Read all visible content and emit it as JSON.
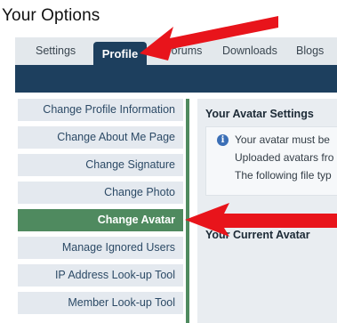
{
  "page": {
    "title": "Your Options"
  },
  "tabs": [
    {
      "label": "Settings"
    },
    {
      "label": "Profile",
      "active": true
    },
    {
      "label": "Forums"
    },
    {
      "label": "Downloads"
    },
    {
      "label": "Blogs"
    }
  ],
  "sidebar": {
    "items": [
      {
        "label": "Change Profile Information"
      },
      {
        "label": "Change About Me Page"
      },
      {
        "label": "Change Signature"
      },
      {
        "label": "Change Photo"
      },
      {
        "label": "Change Avatar",
        "active": true
      },
      {
        "label": "Manage Ignored Users"
      },
      {
        "label": "IP Address Look-up Tool"
      },
      {
        "label": "Member Look-up Tool"
      }
    ]
  },
  "content": {
    "section_title": "Your Avatar Settings",
    "notice_lines": [
      "Your avatar must be",
      "Uploaded avatars fro",
      "The following file typ"
    ],
    "current_avatar_title": "Your Current Avatar"
  },
  "colors": {
    "nav_dark": "#1d3f5e",
    "active_green": "#4f8a5f",
    "annotation_arrow": "#e8141b"
  },
  "icons": {
    "notice": "info-icon",
    "annotations": "red-arrow-icon"
  }
}
